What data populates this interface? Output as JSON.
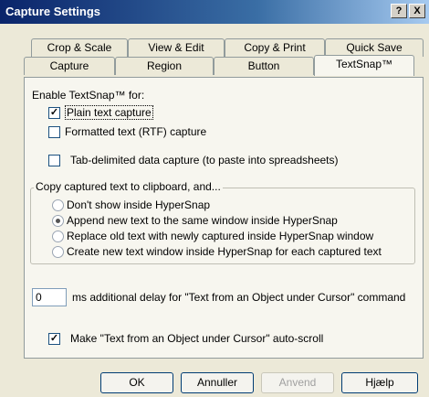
{
  "window": {
    "title": "Capture Settings",
    "help_label": "?",
    "close_label": "X"
  },
  "tabs": {
    "row1": [
      "Crop & Scale",
      "View & Edit",
      "Copy & Print",
      "Quick Save"
    ],
    "row2": [
      "Capture",
      "Region",
      "Button",
      "TextSnap™"
    ],
    "active": "TextSnap™"
  },
  "panel": {
    "enable_heading": "Enable TextSnap™ for:",
    "checkboxes": [
      {
        "label": "Plain text capture",
        "checked": true
      },
      {
        "label": "Formatted text (RTF) capture",
        "checked": false
      },
      {
        "label": "Tab-delimited data capture (to paste into spreadsheets)",
        "checked": false
      }
    ],
    "group": {
      "title": "Copy captured text to clipboard, and...",
      "options": [
        {
          "label": "Don't show inside HyperSnap",
          "selected": false
        },
        {
          "label": "Append new text to the same window inside HyperSnap",
          "selected": true
        },
        {
          "label": "Replace old text with newly captured inside HyperSnap window",
          "selected": false
        },
        {
          "label": "Create new text window inside HyperSnap for each captured text",
          "selected": false
        }
      ]
    },
    "delay": {
      "value": "0",
      "label": "ms additional delay for \"Text from an Object under Cursor\" command"
    },
    "autoscroll": {
      "label": "Make \"Text from an Object under Cursor\" auto-scroll",
      "checked": true
    }
  },
  "buttons": {
    "ok": "OK",
    "cancel": "Annuller",
    "apply": "Anvend",
    "help": "Hjælp"
  },
  "check_mark": "✓"
}
